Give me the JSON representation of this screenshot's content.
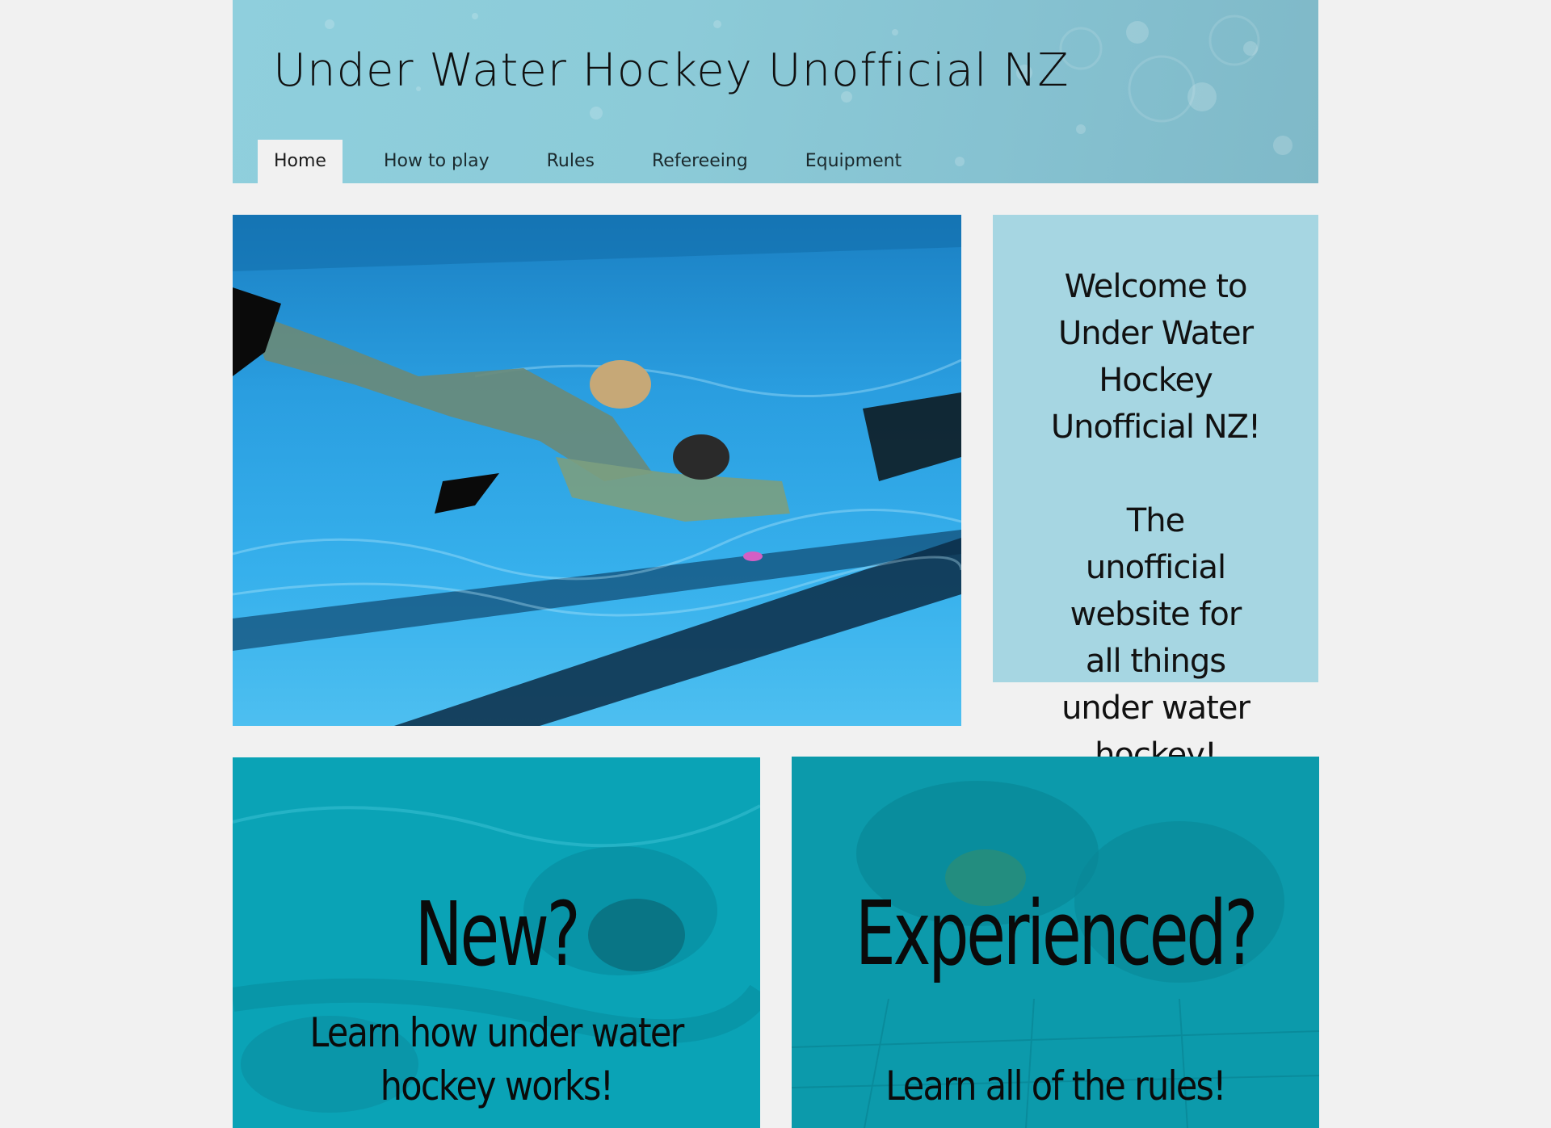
{
  "site": {
    "title": "Under Water Hockey Unofficial NZ"
  },
  "nav": {
    "items": [
      {
        "label": "Home",
        "active": true
      },
      {
        "label": "How to play",
        "active": false
      },
      {
        "label": "Rules",
        "active": false
      },
      {
        "label": "Refereeing",
        "active": false
      },
      {
        "label": "Equipment",
        "active": false
      }
    ]
  },
  "welcome": {
    "line1": "Welcome to Under Water Hockey Unofficial NZ!",
    "line2": "The unofficial website for all things under water hockey!"
  },
  "cards": {
    "new": {
      "title": "New?",
      "subtitle": "Learn how under water hockey works!"
    },
    "experienced": {
      "title": "Experienced?",
      "subtitle": "Learn all of the rules!"
    }
  },
  "colors": {
    "page_bg": "#f1f1f1",
    "header_bg": "#8ccbd8",
    "welcome_bg": "#a6d6e2",
    "card_bg": "#0aa3b6",
    "pool_blue": "#1f8fd0"
  }
}
